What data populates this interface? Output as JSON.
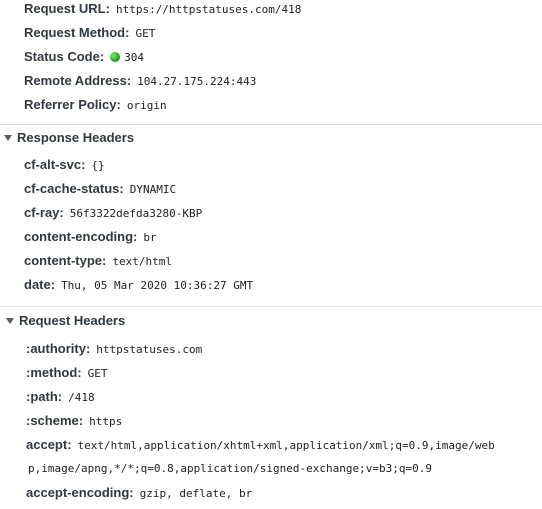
{
  "general": {
    "request_url": {
      "label": "Request URL:",
      "value": "https://httpstatuses.com/418"
    },
    "request_method": {
      "label": "Request Method:",
      "value": "GET"
    },
    "status_code": {
      "label": "Status Code:",
      "value": "304",
      "status_color": "#22aa22"
    },
    "remote_address": {
      "label": "Remote Address:",
      "value": "104.27.175.224:443"
    },
    "referrer_policy": {
      "label": "Referrer Policy:",
      "value": "origin"
    }
  },
  "response_headers": {
    "title": "Response Headers",
    "items": [
      {
        "label": "cf-alt-svc:",
        "value": "{}"
      },
      {
        "label": "cf-cache-status:",
        "value": "DYNAMIC"
      },
      {
        "label": "cf-ray:",
        "value": "56f3322defda3280-KBP"
      },
      {
        "label": "content-encoding:",
        "value": "br"
      },
      {
        "label": "content-type:",
        "value": "text/html"
      },
      {
        "label": "date:",
        "value": "Thu, 05 Mar 2020 10:36:27 GMT"
      }
    ]
  },
  "request_headers": {
    "title": "Request Headers",
    "items": [
      {
        "label": ":authority:",
        "value": "httpstatuses.com"
      },
      {
        "label": ":method:",
        "value": "GET"
      },
      {
        "label": ":path:",
        "value": "/418"
      },
      {
        "label": ":scheme:",
        "value": "https"
      },
      {
        "label": "accept:",
        "value": "text/html,application/xhtml+xml,application/xml;q=0.9,image/web",
        "value_cont": "p,image/apng,*/*;q=0.8,application/signed-exchange;v=b3;q=0.9"
      },
      {
        "label": "accept-encoding:",
        "value": "gzip, deflate, br"
      }
    ]
  }
}
